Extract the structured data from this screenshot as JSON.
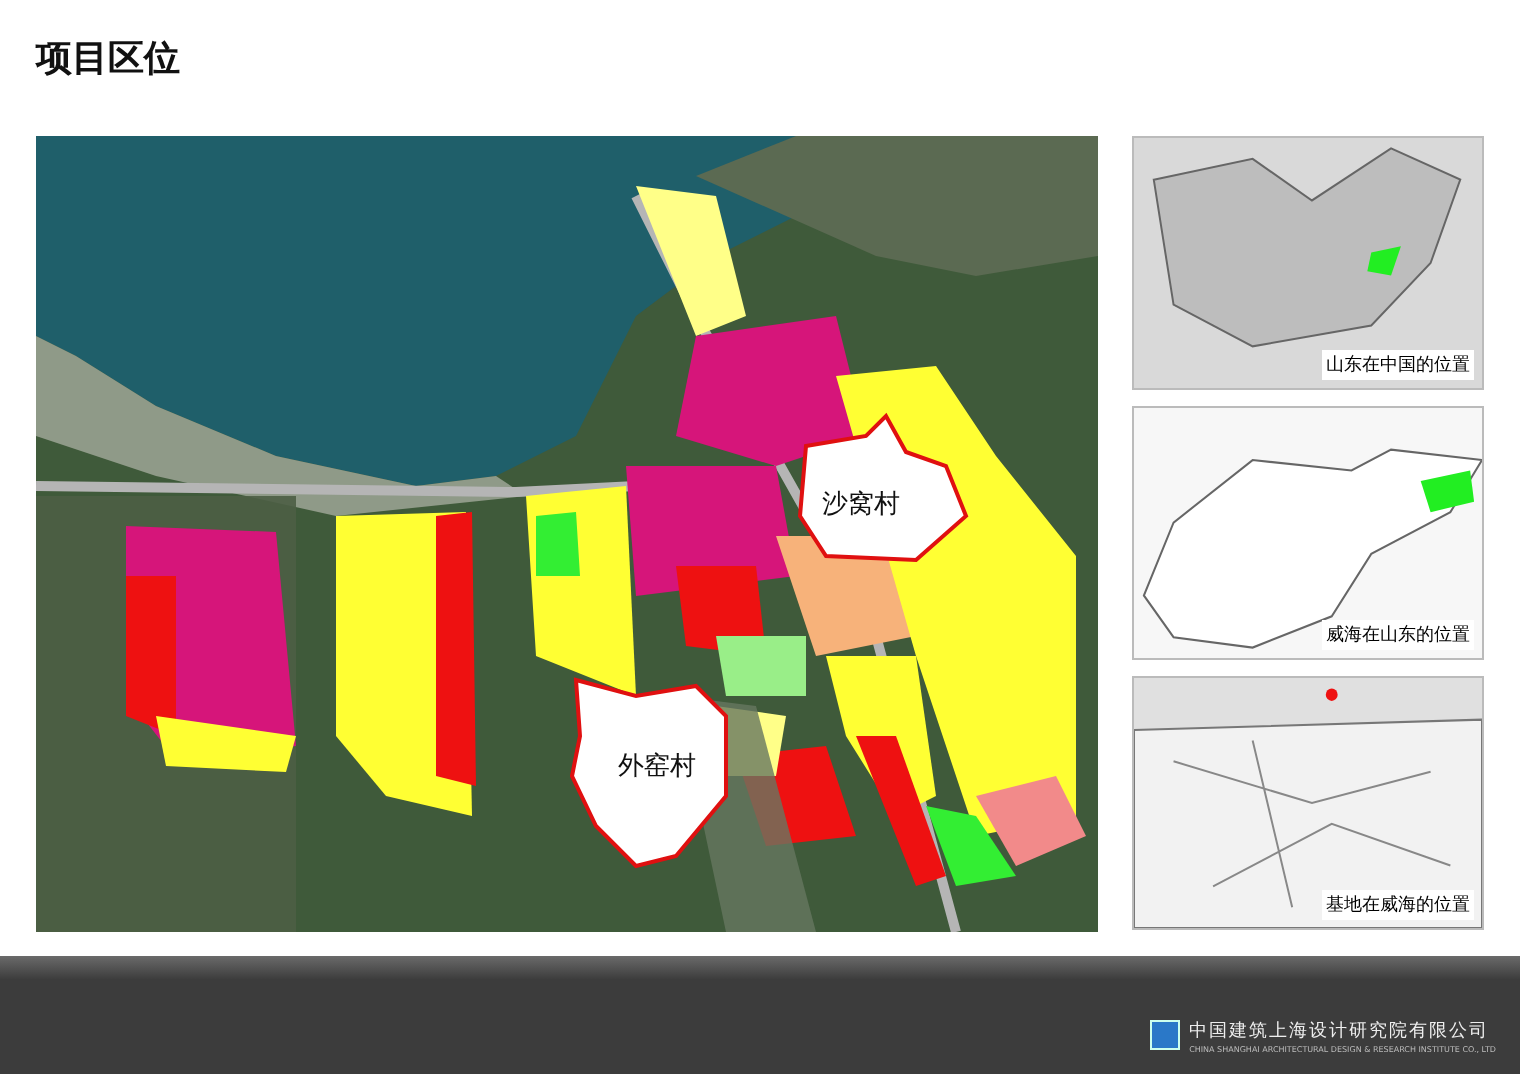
{
  "title": "项目区位",
  "site_map": {
    "villages": [
      {
        "name": "沙窝村"
      },
      {
        "name": "外窑村"
      }
    ]
  },
  "location_maps": [
    {
      "caption": "山东在中国的位置",
      "kind": "china"
    },
    {
      "caption": "威海在山东的位置",
      "kind": "province"
    },
    {
      "caption": "基地在威海的位置",
      "kind": "city"
    }
  ],
  "footer": {
    "company_name": "中国建筑上海设计研究院有限公司",
    "company_name_en": "CHINA SHANGHAI ARCHITECTURAL DESIGN & RESEARCH INSTITUTE CO., LTD"
  }
}
